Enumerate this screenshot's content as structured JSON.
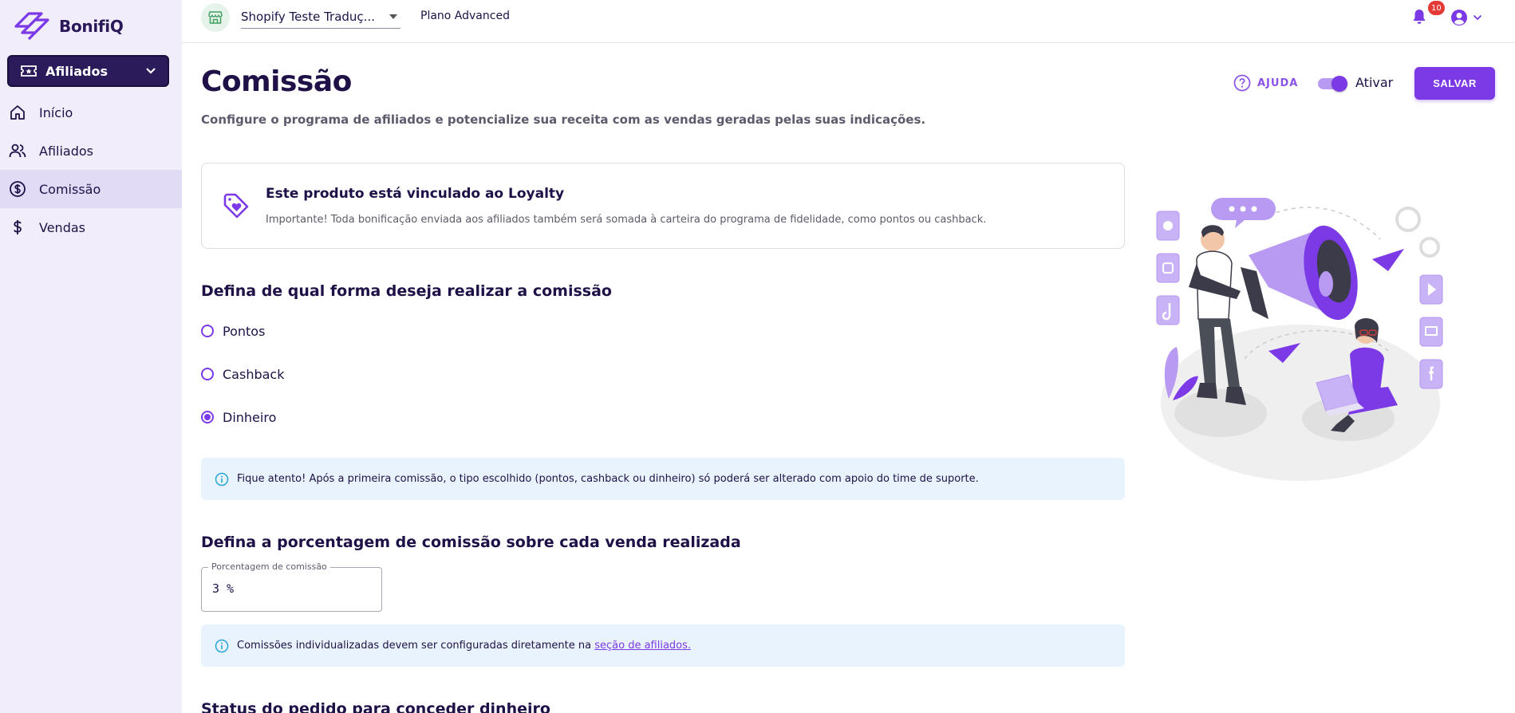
{
  "brand": {
    "name": "BonifiQ",
    "accent": "#7c3ae6",
    "dark": "#2b1b5a"
  },
  "sidebar": {
    "module": "Afiliados",
    "items": [
      {
        "label": "Início",
        "icon": "home-icon",
        "active": false
      },
      {
        "label": "Afiliados",
        "icon": "users-icon",
        "active": false
      },
      {
        "label": "Comissão",
        "icon": "dollar-circle-icon",
        "active": true
      },
      {
        "label": "Vendas",
        "icon": "dollar-icon",
        "active": false
      }
    ]
  },
  "topbar": {
    "store_name": "Shopify Teste Traduç...",
    "plan": "Plano Advanced",
    "notifications_count": "10"
  },
  "header": {
    "title": "Comissão",
    "subtitle": "Configure o programa de afiliados e potencialize sua receita com as vendas geradas pelas suas indicações.",
    "help_label": "AJUDA",
    "toggle_label": "Ativar",
    "toggle_on": true,
    "save_label": "SALVAR"
  },
  "loyalty": {
    "title": "Este produto está vinculado ao Loyalty",
    "description": "Importante! Toda bonificação enviada aos afiliados também será somada à carteira do programa de fidelidade, como pontos ou cashback."
  },
  "commission_type": {
    "title": "Defina de qual forma deseja realizar a comissão",
    "options": [
      {
        "label": "Pontos",
        "checked": false
      },
      {
        "label": "Cashback",
        "checked": false
      },
      {
        "label": "Dinheiro",
        "checked": true
      }
    ],
    "notice": "Fique atento! Após a primeira comissão, o tipo escolhido (pontos, cashback ou dinheiro) só poderá ser alterado com apoio do time de suporte."
  },
  "percentage": {
    "title": "Defina a porcentagem de comissão sobre cada venda realizada",
    "field_label": "Porcentagem de comissão",
    "value": "3 %",
    "notice_text": "Comissões individualizadas devem ser configuradas diretamente na ",
    "notice_link": "seção de afiliados."
  },
  "status_section": {
    "title": "Status do pedido para conceder dinheiro"
  }
}
